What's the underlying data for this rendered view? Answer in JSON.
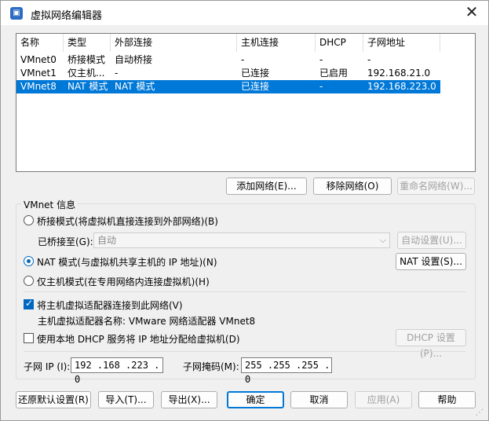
{
  "window": {
    "title": "虚拟网络编辑器",
    "app_icon": "vmware-network-icon",
    "close_icon": "close-icon"
  },
  "table": {
    "headers": [
      "名称",
      "类型",
      "外部连接",
      "主机连接",
      "DHCP",
      "子网地址"
    ],
    "rows": [
      [
        "VMnet0",
        "桥接模式",
        "自动桥接",
        "-",
        "-",
        "-"
      ],
      [
        "VMnet1",
        "仅主机...",
        "-",
        "已连接",
        "已启用",
        "192.168.21.0"
      ],
      [
        "VMnet8",
        "NAT 模式",
        "NAT 模式",
        "已连接",
        "-",
        "192.168.223.0"
      ]
    ],
    "selected_row": 2,
    "selected_color": "#0078d7"
  },
  "buttons": {
    "add_network": "添加网络(E)...",
    "remove_network": "移除网络(O)",
    "rename_network": "重命名网络(W)..."
  },
  "vmnet_info": {
    "label": "VMnet 信息",
    "bridge_mode": "桥接模式(将虚拟机直接连接到外部网络)(B)",
    "bridged_to_label": "已桥接至(G):",
    "bridged_to_value": "自动",
    "auto_settings": "自动设置(U)...",
    "nat_mode": "NAT 模式(与虚拟机共享主机的 IP 地址)(N)",
    "nat_settings": "NAT 设置(S)...",
    "host_only_mode": "仅主机模式(在专用网络内连接虚拟机)(H)",
    "selected_mode": "nat",
    "connect_adapter": "将主机虚拟适配器连接到此网络(V)",
    "connect_adapter_checked": true,
    "adapter_name": "主机虚拟适配器名称: VMware 网络适配器 VMnet8",
    "use_dhcp": "使用本地 DHCP 服务将 IP 地址分配给虚拟机(D)",
    "use_dhcp_checked": false,
    "dhcp_settings": "DHCP 设置(P)...",
    "subnet_ip_label": "子网 IP (I):",
    "subnet_ip_value": "192 .168 .223 . 0",
    "subnet_mask_label": "子网掩码(M):",
    "subnet_mask_value": "255 .255 .255 . 0"
  },
  "footer": {
    "restore_defaults": "还原默认设置(R)",
    "import": "导入(T)...",
    "export": "导出(X)...",
    "ok": "确定",
    "cancel": "取消",
    "apply": "应用(A)",
    "help": "帮助"
  }
}
